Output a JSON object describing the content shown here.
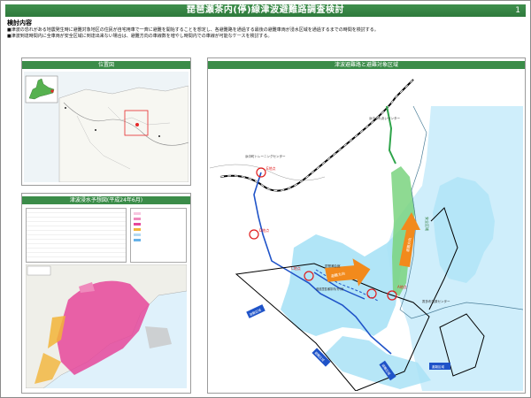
{
  "header": {
    "title": "琵琶瀬茶内(停)線津波避難路調査検討",
    "page_number": "1"
  },
  "study": {
    "heading": "検討内容",
    "bullet1": "■津波の恐れがある地震発生時に避難対象地区の住民が自宅用車で一斉に避難を開始することを想定し、各避難路を通過する最後の避難車両が浸水区域を通過するまでの時間を検討する。",
    "bullet2": "■津波到達時間内に全車両が安全区域に到達出来ない場合は、避難方向の車線数を増やし時間内での車線が可能なケースを検討する。"
  },
  "panels": {
    "location_title": "位置図",
    "inundation_title": "津波浸水予想図(平成24年6月)",
    "map_title": "津波避難路と避難対象区域"
  },
  "map": {
    "labels": {
      "c_point": "C地点",
      "d_point": "D地点",
      "e_point": "E地点",
      "a_point": "A地点",
      "evac_dir1": "避難方向",
      "evac_dir2": "避難方向",
      "safe_area": "安全区域",
      "zone1": "避難区域",
      "zone2": "避難区域",
      "zone3": "避難区域",
      "zone4": "避難区域",
      "facility1": "浜中ふれあいセンター",
      "facility2": "琵琶瀬会館",
      "facility3": "浜中町トレーニングセンター",
      "facility4": "霧多布湿原センター",
      "road_label": "道道琵琶瀬茶内(停)線"
    }
  },
  "colors": {
    "header_green": "#3f8f4d",
    "panel_green": "#3b8c49",
    "tsunami_blue": "#a9e2f6",
    "safe_green": "#7ad37f",
    "route_blue": "#1f53c8",
    "arrow_orange": "#f28a1c",
    "inundation_pink": "#e6479a"
  }
}
